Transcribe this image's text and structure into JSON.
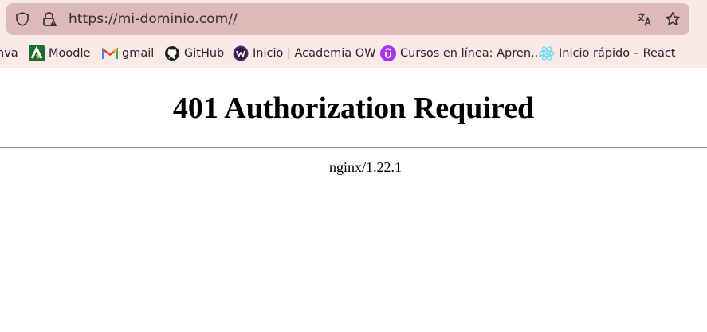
{
  "browser": {
    "url": "https://mi-dominio.com//",
    "icons": {
      "shield": "shield-icon",
      "lock": "lock-warning-icon",
      "translate": "translate-icon",
      "favorite": "star-icon"
    },
    "bookmarks": [
      {
        "label": "nva",
        "icon": "none"
      },
      {
        "label": "Moodle",
        "icon": "moodle-icon"
      },
      {
        "label": "gmail",
        "icon": "gmail-icon"
      },
      {
        "label": "GitHub",
        "icon": "github-icon"
      },
      {
        "label": "Inicio | Academia OW",
        "icon": "academia-ow-icon"
      },
      {
        "label": "Cursos en línea: Apren...",
        "icon": "udemy-icon"
      },
      {
        "label": "Inicio rápido – React",
        "icon": "react-icon"
      }
    ]
  },
  "page": {
    "title": "401 Authorization Required",
    "server": "nginx/1.22.1"
  },
  "colors": {
    "chrome_bg": "#f9e9e7",
    "urlbar_bg": "#dcbab8",
    "moodle": "#1e6b32",
    "academia": "#4a2a6a",
    "udemy": "#a435f0",
    "react": "#61dafb"
  }
}
